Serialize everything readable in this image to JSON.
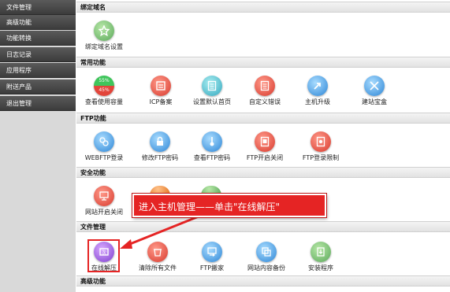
{
  "sidebar": {
    "items": [
      {
        "label": "文件管理"
      },
      {
        "label": "高级功能"
      },
      {
        "label": "功能转换"
      },
      {
        "label": "日志记录"
      },
      {
        "label": "应用程序"
      },
      {
        "label": "附送产品"
      },
      {
        "label": "退出管理"
      }
    ]
  },
  "sections": {
    "domain": {
      "title": "绑定域名",
      "tools": [
        {
          "label": "绑定域名设置",
          "icon": "star-icon"
        }
      ]
    },
    "common": {
      "title": "常用功能",
      "tools": [
        {
          "label": "查看使用容量",
          "icon": "usage-pie-icon",
          "pie_top": "55%",
          "pie_bottom": "45%"
        },
        {
          "label": "ICP备案",
          "icon": "icp-icon"
        },
        {
          "label": "设置默认首页",
          "icon": "default-page-icon"
        },
        {
          "label": "自定义错误",
          "icon": "custom-error-icon"
        },
        {
          "label": "主机升级",
          "icon": "upgrade-icon"
        },
        {
          "label": "建站宝盒",
          "icon": "sitebox-icon"
        }
      ]
    },
    "ftp": {
      "title": "FTP功能",
      "tools": [
        {
          "label": "WEBFTP登录",
          "icon": "webftp-icon"
        },
        {
          "label": "修改FTP密码",
          "icon": "lock-icon"
        },
        {
          "label": "查看FTP密码",
          "icon": "key-icon"
        },
        {
          "label": "FTP开启关闭",
          "icon": "ftp-toggle-icon"
        },
        {
          "label": "FTP登录限制",
          "icon": "ftp-restrict-icon"
        }
      ]
    },
    "security": {
      "title": "安全功能",
      "tools": [
        {
          "label": "网站开启关闭",
          "icon": "site-toggle-icon"
        }
      ]
    },
    "files": {
      "title": "文件管理",
      "tools": [
        {
          "label": "在线解压",
          "icon": "unzip-icon"
        },
        {
          "label": "清除所有文件",
          "icon": "clear-files-icon"
        },
        {
          "label": "FTP搬家",
          "icon": "ftp-move-icon"
        },
        {
          "label": "网站内容备份",
          "icon": "backup-icon"
        },
        {
          "label": "安装程序",
          "icon": "install-icon"
        }
      ]
    },
    "advanced": {
      "title": "高级功能"
    }
  },
  "callout": {
    "text": "进入主机管理——单击\"在线解压\""
  },
  "colors": {
    "accent_red": "#e52424",
    "sidebar_bg": "#3c3c3c"
  }
}
